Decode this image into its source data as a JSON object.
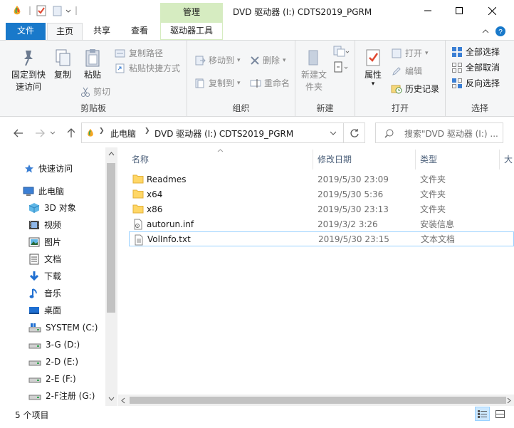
{
  "titlebar": {
    "title": "DVD 驱动器 (I:) CDTS2019_PGRM",
    "context_tab": "管理",
    "quick_access_icons": [
      "colorful-drop-icon",
      "properties-check-icon",
      "new-folder-icon",
      "customize-chevron-icon"
    ]
  },
  "ribbon_tabs": {
    "file": "文件",
    "home": "主页",
    "share": "共享",
    "view": "查看",
    "drive_tools": "驱动器工具"
  },
  "clipboard": {
    "label": "剪贴板",
    "pin": "固定到快速访问",
    "copy": "复制",
    "paste": "粘贴",
    "copy_path": "复制路径",
    "paste_shortcut": "粘贴快捷方式",
    "cut": "剪切"
  },
  "organize": {
    "label": "组织",
    "move_to": "移动到",
    "copy_to": "复制到",
    "delete": "删除",
    "rename": "重命名"
  },
  "new": {
    "label": "新建",
    "new_folder": "新建文件夹"
  },
  "open": {
    "label": "打开",
    "properties": "属性",
    "open": "打开",
    "edit": "编辑",
    "history": "历史记录"
  },
  "select": {
    "label": "选择",
    "select_all": "全部选择",
    "select_none": "全部取消",
    "invert": "反向选择"
  },
  "address": {
    "root": "此电脑",
    "current": "DVD 驱动器 (I:) CDTS2019_PGRM",
    "search_placeholder": "搜索\"DVD 驱动器 (I:) ..."
  },
  "nav": {
    "quick_access": "快速访问",
    "this_pc": "此电脑",
    "items": [
      {
        "label": "3D 对象",
        "icon": "3d-objects-icon"
      },
      {
        "label": "视频",
        "icon": "videos-icon"
      },
      {
        "label": "图片",
        "icon": "pictures-icon"
      },
      {
        "label": "文档",
        "icon": "documents-icon"
      },
      {
        "label": "下载",
        "icon": "downloads-icon"
      },
      {
        "label": "音乐",
        "icon": "music-icon"
      },
      {
        "label": "桌面",
        "icon": "desktop-icon"
      },
      {
        "label": "SYSTEM (C:)",
        "icon": "system-drive-icon"
      },
      {
        "label": "3-G (D:)",
        "icon": "drive-icon"
      },
      {
        "label": "2-D (E:)",
        "icon": "drive-icon"
      },
      {
        "label": "2-E (F:)",
        "icon": "drive-icon"
      },
      {
        "label": "2-F注册 (G:)",
        "icon": "drive-icon"
      }
    ]
  },
  "columns": {
    "name": "名称",
    "date": "修改日期",
    "type": "类型",
    "size": "大"
  },
  "files": [
    {
      "name": "Readmes",
      "date": "2019/5/30 23:09",
      "type": "文件夹",
      "icon": "folder-icon"
    },
    {
      "name": "x64",
      "date": "2019/5/30 5:36",
      "type": "文件夹",
      "icon": "folder-icon"
    },
    {
      "name": "x86",
      "date": "2019/5/30 23:13",
      "type": "文件夹",
      "icon": "folder-icon"
    },
    {
      "name": "autorun.inf",
      "date": "2019/3/2 3:26",
      "type": "安装信息",
      "icon": "settings-file-icon"
    },
    {
      "name": "VolInfo.txt",
      "date": "2019/5/30 23:15",
      "type": "文本文档",
      "icon": "text-file-icon"
    }
  ],
  "status": {
    "count": "5 个项目"
  },
  "colors": {
    "accent": "#1979ca",
    "context_tab": "#d6ecc1",
    "folder": "#ffd766",
    "selection_border": "#99d1ff"
  }
}
